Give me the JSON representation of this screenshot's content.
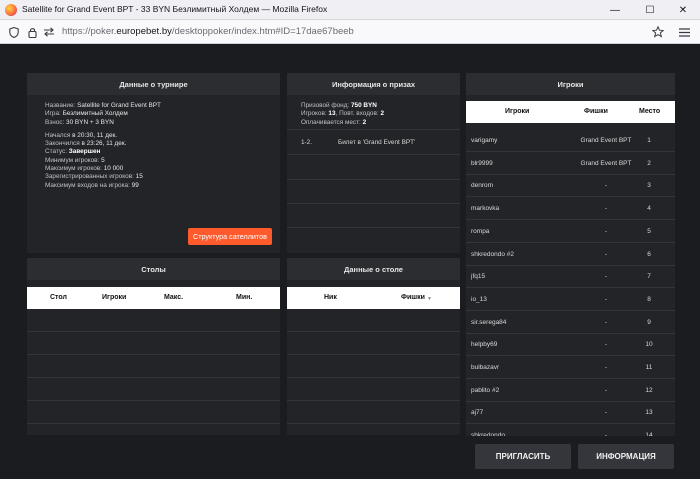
{
  "window": {
    "title": "Satellite for Grand Event BPT - 33 BYN Безлимитный Холдем — Mozilla Firefox",
    "minimize": "—",
    "maximize": "☐",
    "close": "✕"
  },
  "urlbar": {
    "prefix": "https://poker.",
    "domain": "europebet.by",
    "path": "/desktoppoker/index.htm#ID=17dae67beeb"
  },
  "tournament": {
    "header": "Данные о турнире",
    "name_label": "Название:",
    "name": "Satellite for Grand Event BPT",
    "game_label": "Игра:",
    "game": "Безлимитный Холдем",
    "buyin_label": "Взнос:",
    "buyin": "30 BYN + 3 BYN",
    "started_label": "Начался",
    "started": "в 20:30, 11 дек.",
    "ended_label": "Закончился",
    "ended": "в 23:26, 11 дек.",
    "status_label": "Статус:",
    "status": "Завершен",
    "min_players_label": "Минимум игроков:",
    "min_players": "5",
    "max_players_label": "Максимум игроков:",
    "max_players": "10 000",
    "registered_label": "Зарегистрированных игроков:",
    "registered": "15",
    "max_entries_label": "Максимум входов на игрока:",
    "max_entries": "99",
    "satellites_button": "Структура сателлитов"
  },
  "prizes": {
    "header": "Информация о призах",
    "fund_label": "Призовой фонд:",
    "fund": "750 BYN",
    "players_label": "Игроков:",
    "players": "13",
    "reentries_label": "Повт. входов:",
    "reentries": "2",
    "paid_label": "Оплачивается мест:",
    "paid": "2",
    "rows": [
      {
        "place": "1-2.",
        "prize": "Билет в 'Grand Event BPT'"
      }
    ]
  },
  "tables": {
    "header": "Столы",
    "columns": [
      "Стол",
      "Игроки",
      "Макс.",
      "Мин."
    ]
  },
  "table_data": {
    "header": "Данные о столе",
    "columns": [
      "Ник",
      "Фишки"
    ],
    "sort_icon": "▼"
  },
  "players": {
    "header": "Игроки",
    "columns": [
      "Игроки",
      "Фишки",
      "Место"
    ],
    "rows": [
      {
        "name": "varigamy",
        "chips": "Grand Event BPT",
        "place": "1"
      },
      {
        "name": "blr9999",
        "chips": "Grand Event BPT",
        "place": "2"
      },
      {
        "name": "denrom",
        "chips": "-",
        "place": "3"
      },
      {
        "name": "markovka",
        "chips": "-",
        "place": "4"
      },
      {
        "name": "rompa",
        "chips": "-",
        "place": "5"
      },
      {
        "name": "shkredondo #2",
        "chips": "-",
        "place": "6"
      },
      {
        "name": "jfq15",
        "chips": "-",
        "place": "7"
      },
      {
        "name": "io_13",
        "chips": "-",
        "place": "8"
      },
      {
        "name": "sir.serega84",
        "chips": "-",
        "place": "9"
      },
      {
        "name": "helpby69",
        "chips": "-",
        "place": "10"
      },
      {
        "name": "bulbazavr",
        "chips": "-",
        "place": "11"
      },
      {
        "name": "pablito #2",
        "chips": "-",
        "place": "12"
      },
      {
        "name": "aj77",
        "chips": "-",
        "place": "13"
      },
      {
        "name": "shkredondo",
        "chips": "-",
        "place": "14"
      }
    ]
  },
  "actions": {
    "invite": "ПРИГЛАСИТЬ",
    "info": "ИНФОРМАЦИЯ"
  },
  "colors": {
    "accent": "#ff5a2c",
    "background": "#1b1c1f",
    "panel": "#232428"
  }
}
